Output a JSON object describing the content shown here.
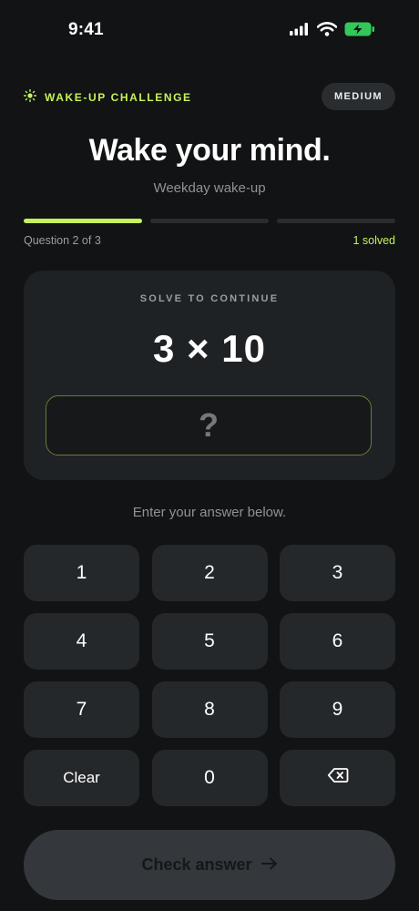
{
  "status_bar": {
    "time": "9:41",
    "icons": [
      "signal-icon",
      "wifi-icon",
      "battery-charging-icon"
    ],
    "battery_color": "#34c759"
  },
  "header": {
    "icon": "sun-icon",
    "label": "WAKE-UP CHALLENGE",
    "difficulty": "MEDIUM",
    "accent": "#c6f35a"
  },
  "title": "Wake your mind.",
  "subtitle": "Weekday wake-up",
  "progress": {
    "steps_total": 3,
    "steps_completed": 1,
    "left_label": "Question 2 of 3",
    "right_label": "1 solved"
  },
  "challenge": {
    "label": "SOLVE TO CONTINUE",
    "equation": "3 × 10",
    "answer_placeholder": "?"
  },
  "hint": "Enter your answer below.",
  "keypad": {
    "keys": [
      "1",
      "2",
      "3",
      "4",
      "5",
      "6",
      "7",
      "8",
      "9",
      "Clear",
      "0"
    ],
    "backspace_icon": "backspace-icon"
  },
  "check_button": {
    "label": "Check answer",
    "icon": "arrow-right-icon"
  }
}
